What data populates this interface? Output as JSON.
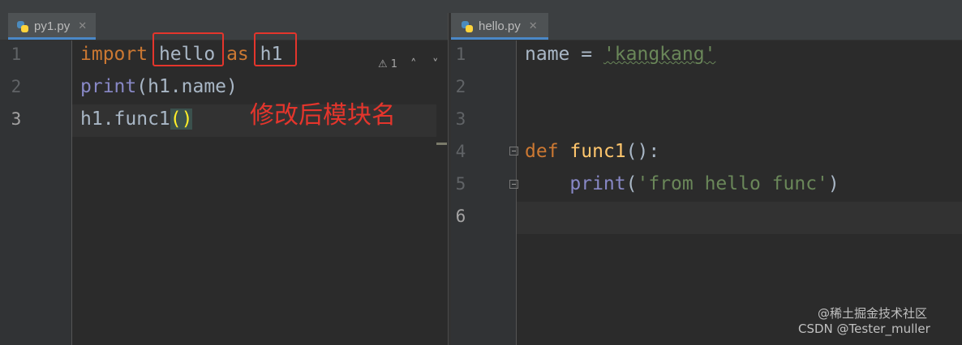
{
  "editors": {
    "left": {
      "tab": {
        "label": "py1.py",
        "close_icon": "close-icon"
      },
      "line_numbers": [
        "1",
        "2",
        "3"
      ],
      "lines": [
        [
          {
            "t": "import",
            "c": "kw"
          },
          {
            "t": " ",
            "c": ""
          },
          {
            "t": "hello",
            "c": ""
          },
          {
            "t": " ",
            "c": ""
          },
          {
            "t": "as",
            "c": "kw"
          },
          {
            "t": " ",
            "c": ""
          },
          {
            "t": "h1",
            "c": ""
          }
        ],
        [
          {
            "t": "print",
            "c": "bi"
          },
          {
            "t": "(h1.name)",
            "c": ""
          }
        ],
        [
          {
            "t": "h1.func1",
            "c": ""
          },
          {
            "t": "()",
            "c": "paren"
          }
        ]
      ],
      "inspection": {
        "icon": "warning-icon",
        "count": "1"
      },
      "nav": {
        "up": "˄",
        "down": "˅"
      },
      "annotation": "修改后模块名"
    },
    "right": {
      "tab": {
        "label": "hello.py",
        "close_icon": "close-icon"
      },
      "line_numbers": [
        "1",
        "2",
        "3",
        "4",
        "5",
        "6"
      ],
      "lines": [
        [
          {
            "t": "name = ",
            "c": ""
          },
          {
            "t": "'kangkang'",
            "c": "str"
          }
        ],
        [],
        [],
        [
          {
            "t": "def",
            "c": "kw"
          },
          {
            "t": " ",
            "c": ""
          },
          {
            "t": "func1",
            "c": "fn"
          },
          {
            "t": "():",
            "c": ""
          }
        ],
        [
          {
            "t": "    ",
            "c": ""
          },
          {
            "t": "print",
            "c": "bi"
          },
          {
            "t": "(",
            "c": ""
          },
          {
            "t": "'from hello func'",
            "c": "str"
          },
          {
            "t": ")",
            "c": ""
          }
        ],
        []
      ]
    }
  },
  "watermark": {
    "line1": "@稀土掘金技术社区",
    "line2": "CSDN @Tester_muller"
  },
  "colors": {
    "keyword": "#cc7832",
    "builtin": "#8888c6",
    "string": "#6a8759",
    "function": "#ffc66d",
    "annotation": "#e4352c"
  }
}
